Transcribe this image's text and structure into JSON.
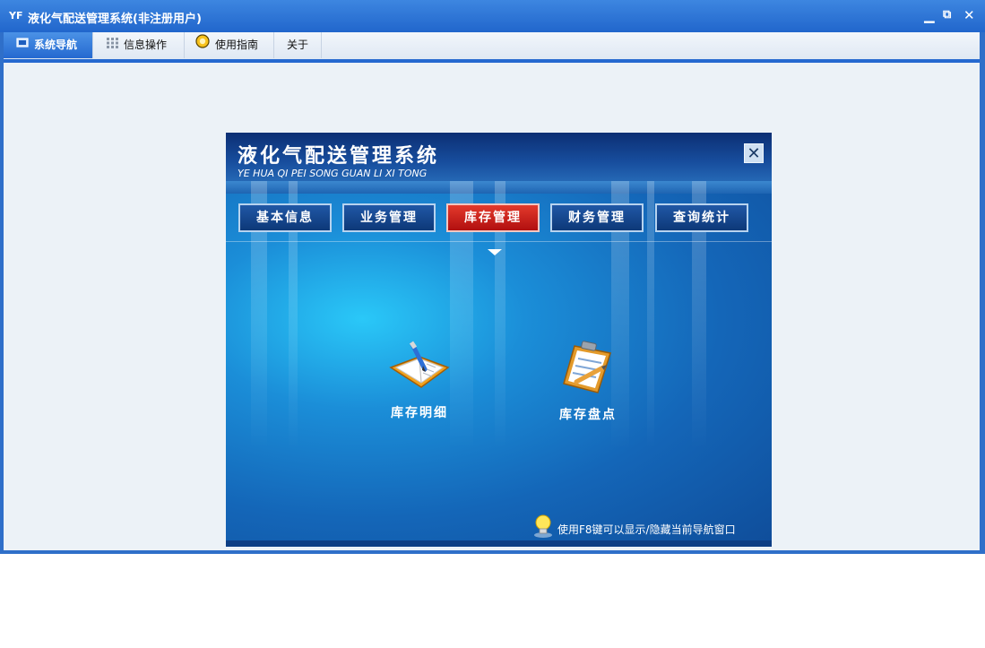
{
  "window": {
    "app_icon": "YF",
    "title": "液化气配送管理系统(非注册用户)",
    "minimize_glyph": "▁",
    "restore_glyph": "⧉",
    "close_glyph": "✕"
  },
  "tabs": [
    {
      "label": "系统导航",
      "icon": "monitor-icon",
      "active": true
    },
    {
      "label": "信息操作",
      "icon": "grid-icon",
      "active": false
    },
    {
      "label": "使用指南",
      "icon": "help-circle-icon",
      "active": false
    },
    {
      "label": "关于",
      "icon": "",
      "active": false
    }
  ],
  "panel": {
    "title": "液化气配送管理系统",
    "subtitle": "YE HUA QI PEI SONG GUAN LI XI TONG",
    "close_glyph": "✕",
    "menu": [
      {
        "label": "基本信息",
        "active": false
      },
      {
        "label": "业务管理",
        "active": false
      },
      {
        "label": "库存管理",
        "active": true
      },
      {
        "label": "财务管理",
        "active": false
      },
      {
        "label": "查询统计",
        "active": false
      }
    ],
    "items": [
      {
        "label": "库存明细",
        "icon": "notebook-pencil-icon"
      },
      {
        "label": "库存盘点",
        "icon": "clipboard-pencil-icon"
      }
    ],
    "tip": "使用F8键可以显示/隐藏当前导航窗口"
  },
  "colors": {
    "titlebar": "#2166cc",
    "active_tab": "#2569d0",
    "active_menu": "#c81f1a",
    "content_bg": "#ecf2f7"
  }
}
